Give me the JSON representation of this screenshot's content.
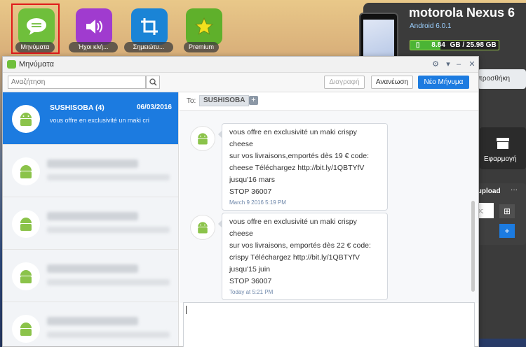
{
  "desktop": {
    "icons": [
      {
        "label": "Μηνύματα",
        "color": "#6fbf3b"
      },
      {
        "label": "Ήχοι κλή...",
        "color": "#a03bcf"
      },
      {
        "label": "Σημειώτυ...",
        "color": "#1a84d6"
      },
      {
        "label": "Premium",
        "color": "#5fb02b"
      }
    ]
  },
  "device": {
    "name": "motorola Nexus 6",
    "os": "Android 6.0.1",
    "storage_used": "8.84",
    "storage_text": "GB / 25.98 GB",
    "storage_fraction": 0.34
  },
  "side_panel": {
    "partial_button": "προσθήκη",
    "app_tile_label": "Εφαρμογή",
    "upload_label": "/upload",
    "upload_more": "···",
    "partial_text": "υς"
  },
  "window": {
    "title": "Μηνύματα",
    "search_placeholder": "Αναζήτηση",
    "delete_label": "Διαγραφή",
    "refresh_label": "Ανανέωση",
    "new_message_label": "Νέο Μήνυμα"
  },
  "threads": [
    {
      "name": "SUSHISOBA (4)",
      "date": "06/03/2016",
      "preview": "vous offre en exclusivité un maki cri",
      "selected": true
    }
  ],
  "conversation": {
    "to_label": "To:",
    "recipient": "SUSHISOBA",
    "add_icon": "plus-icon",
    "messages": [
      {
        "lines": [
          "vous offre en exclusivité un maki crispy cheese",
          "sur vos livraisons,emportés dès 19 € code:",
          "cheese Téléchargez http://bit.ly/1QBTYfV",
          "jusqu'16 mars",
          "STOP 36007"
        ],
        "time": "March 9 2016 5:19 PM"
      },
      {
        "lines": [
          "vous offre en exclusivité un maki crispy cheese",
          "sur vos livraisons, emportés dès 22 € code:",
          "crispy Téléchargez http://bit.ly/1QBTYfV",
          "jusqu'15 juin",
          "STOP 36007"
        ],
        "time": "Today at 5:21 PM"
      }
    ]
  }
}
